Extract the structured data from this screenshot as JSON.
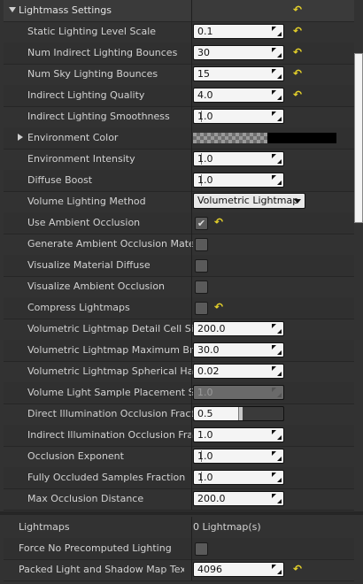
{
  "section": {
    "title": "Lightmass Settings",
    "properties": [
      {
        "label": "Static Lighting Level Scale",
        "value": "0.1",
        "reset": true
      },
      {
        "label": "Num Indirect Lighting Bounces",
        "value": "30",
        "reset": true
      },
      {
        "label": "Num Sky Lighting Bounces",
        "value": "15",
        "reset": true
      },
      {
        "label": "Indirect Lighting Quality",
        "value": "4.0",
        "reset": true
      },
      {
        "label": "Indirect Lighting Smoothness",
        "value": "1.0",
        "reset": false
      },
      {
        "label": "Environment Color",
        "kind": "color"
      },
      {
        "label": "Environment Intensity",
        "value": "1.0",
        "reset": false
      },
      {
        "label": "Diffuse Boost",
        "value": "1.0",
        "reset": false
      },
      {
        "label": "Volume Lighting Method",
        "kind": "combo",
        "value": "Volumetric Lightmap"
      },
      {
        "label": "Use Ambient Occlusion",
        "kind": "check",
        "checked": true,
        "reset": true
      },
      {
        "label": "Generate Ambient Occlusion Material Mask",
        "kind": "check",
        "checked": false
      },
      {
        "label": "Visualize Material Diffuse",
        "kind": "check",
        "checked": false
      },
      {
        "label": "Visualize Ambient Occlusion",
        "kind": "check",
        "checked": false
      },
      {
        "label": "Compress Lightmaps",
        "kind": "check",
        "checked": false,
        "reset": true
      },
      {
        "label": "Volumetric Lightmap Detail Cell Size",
        "value": "200.0",
        "reset": false
      },
      {
        "label": "Volumetric Lightmap Maximum Brick Memory Mb",
        "value": "30.0",
        "reset": false
      },
      {
        "label": "Volumetric Lightmap Spherical Harmonic Smoothing",
        "value": "0.02",
        "reset": false
      },
      {
        "label": "Volume Light Sample Placement Scale",
        "value": "1.0",
        "disabled": true
      },
      {
        "label": "Direct Illumination Occlusion Fraction",
        "value": "0.5",
        "slider": 0.5
      },
      {
        "label": "Indirect Illumination Occlusion Fraction",
        "value": "1.0"
      },
      {
        "label": "Occlusion Exponent",
        "value": "1.0"
      },
      {
        "label": "Fully Occluded Samples Fraction",
        "value": "1.0"
      },
      {
        "label": "Max Occlusion Distance",
        "value": "200.0"
      }
    ]
  },
  "lightmaps": {
    "label": "Lightmaps",
    "value": "0 Lightmap(s)",
    "force_label": "Force No Precomputed Lighting",
    "packed_label": "Packed Light and Shadow Map Texture Size",
    "packed_value": "4096"
  },
  "reset_icon": "reset-to-default-icon",
  "colors": {
    "reset": "#e5d12a",
    "panel": "#323232",
    "field": "#f4f4f4"
  }
}
